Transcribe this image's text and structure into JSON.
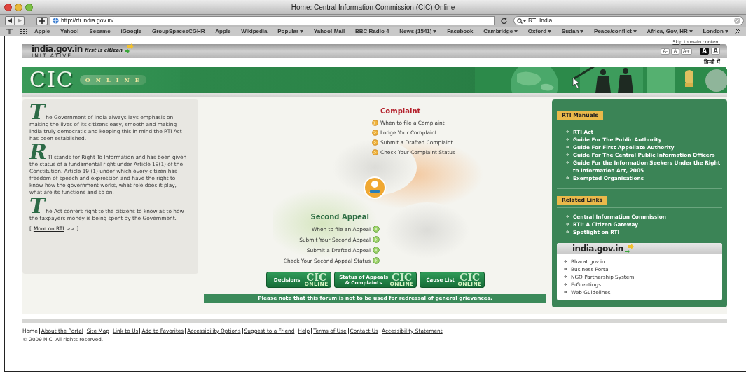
{
  "window": {
    "title": "Home: Central Information Commission (CIC) Online"
  },
  "toolbar": {
    "url": "http://rti.india.gov.in/",
    "search": "RTI India"
  },
  "bookmarks": [
    {
      "label": "Apple",
      "dropdown": false
    },
    {
      "label": "Yahoo!",
      "dropdown": false
    },
    {
      "label": "Sesame",
      "dropdown": false
    },
    {
      "label": "iGoogle",
      "dropdown": false
    },
    {
      "label": "GroupSpacesCGHR",
      "dropdown": false
    },
    {
      "label": "Apple",
      "dropdown": false
    },
    {
      "label": "Wikipedia",
      "dropdown": false
    },
    {
      "label": "Popular",
      "dropdown": true
    },
    {
      "label": "Yahoo! Mail",
      "dropdown": false
    },
    {
      "label": "BBC Radio 4",
      "dropdown": false
    },
    {
      "label": "News (1541)",
      "dropdown": true
    },
    {
      "label": "Facebook",
      "dropdown": false
    },
    {
      "label": "Cambridge",
      "dropdown": true
    },
    {
      "label": "Oxford",
      "dropdown": true
    },
    {
      "label": "Sudan",
      "dropdown": true
    },
    {
      "label": "Peace/conflict",
      "dropdown": true
    },
    {
      "label": "Africa, Gov, HR",
      "dropdown": true
    },
    {
      "label": "London",
      "dropdown": true
    }
  ],
  "page": {
    "skip_link": "Skip to main content",
    "portal_logo": {
      "name": "india.gov.in",
      "tagline": "first is citizen",
      "sub": "INITIATIVE"
    },
    "text_size_buttons": [
      "A-",
      "A",
      "A+"
    ],
    "contrast_buttons": [
      {
        "label": "A",
        "selected": true
      },
      {
        "label": "A",
        "selected": false
      }
    ],
    "language_link": "हिन्दी में",
    "banner": {
      "logo": "CIC",
      "logo_sub": "ONLINE"
    },
    "intro_paragraphs": [
      "The Government of India always lays emphasis on making the lives of its citizens easy, smooth and making India truly democratic and keeping this in mind the RTI Act has been established.",
      "RTI stands for Right To Information and has been given the status of a fundamental right under Article 19(1) of the Constitution. Article 19 (1) under which every citizen has freedom of speech and expression and have the right to know how the government works, what role does it play, what are its functions and so on.",
      "The Act confers right to the citizens to know as to how the taxpayers money is being spent by the Government."
    ],
    "more_link": {
      "prefix": "[",
      "label": "More on RTI",
      "suffix": ">> ]"
    },
    "complaint": {
      "heading": "Complaint",
      "links": [
        "When to file a Complaint",
        "Lodge Your Complaint",
        "Submit a Drafted Complaint",
        "Check Your Complaint Status"
      ]
    },
    "second_appeal": {
      "heading": "Second Appeal",
      "links": [
        "When to file an Appeal",
        "Submit Your Second Appeal",
        "Submit a Drafted Appeal",
        "Check Your Second Appeal Status"
      ]
    },
    "image_buttons": [
      {
        "label": "Decisions",
        "logo": "CIC",
        "logo_sub": "ONLINE"
      },
      {
        "label": "Status of Appeals & Complaints",
        "logo": "CIC",
        "logo_sub": "ONLINE"
      },
      {
        "label": "Cause List",
        "logo": "CIC",
        "logo_sub": "ONLINE"
      }
    ],
    "notice": "Please note that this forum is not to be used for redressal of general grievances.",
    "sidebar": {
      "sections": [
        {
          "heading": "RTI Manuals",
          "links": [
            "RTI Act",
            "Guide For The Public Authority",
            "Guide For First Appellate Authority",
            "Guide For The Central Public Information Officers",
            "Guide For the Information Seekers Under the Right to Information Act, 2005",
            "Exempted Organisations"
          ]
        },
        {
          "heading": "Related Links",
          "links": [
            "Central Information Commission",
            "RTI: A Citizen Gateway",
            "Spotlight on RTI"
          ]
        }
      ],
      "portal_box": {
        "logo": "india.gov.in",
        "links": [
          "Bharat.gov.in",
          "Business Portal",
          "NGO Partnership System",
          "E-Greetings",
          "Web Guidelines"
        ]
      }
    },
    "footer": {
      "links": [
        "Home",
        "About the Portal",
        "Site Map",
        "Link to Us",
        "Add to Favorites",
        "Accessibility Options",
        "Suggest to a Friend",
        "Help",
        "Terms of Use",
        "Contact Us",
        "Accessibility Statement"
      ],
      "copyright": "© 2009 NIC. All rights reserved."
    }
  }
}
